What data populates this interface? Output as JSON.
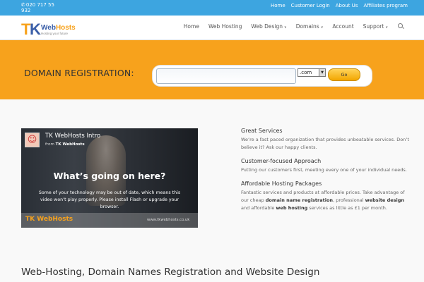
{
  "topbar": {
    "phone": "020 717 55 932",
    "links": [
      "Home",
      "Customer Login",
      "About Us",
      "Affiliates program"
    ]
  },
  "header": {
    "logo": {
      "initials": "TK",
      "name": "WebHosts",
      "tagline": "Hosting your future"
    },
    "nav": [
      {
        "label": "Home",
        "has_dropdown": false
      },
      {
        "label": "Web Hosting",
        "has_dropdown": false
      },
      {
        "label": "Web Design",
        "has_dropdown": true
      },
      {
        "label": "Domains",
        "has_dropdown": true
      },
      {
        "label": "Account",
        "has_dropdown": false
      },
      {
        "label": "Support",
        "has_dropdown": true
      }
    ],
    "search_icon": "search-icon"
  },
  "domain_search": {
    "label": "DOMAIN REGISTRATION:",
    "input_value": "",
    "tld_selected": ".com",
    "go_label": "Go"
  },
  "video": {
    "title": "TK WebHosts Intro",
    "from_prefix": "from",
    "from_name": "TK WebHosts",
    "headline": "What’s going on here?",
    "message": "Some of your technology may be out of date, which means this video won’t play properly. Please install Flash or upgrade your browser.",
    "footer_logo": "TK WebHosts",
    "footer_url": "www.tkwebhosts.co.uk"
  },
  "features": [
    {
      "title": "Great Services",
      "text": "We’re a fast paced organization that provides unbeatable services. Don’t believe it? Ask our happy clients."
    },
    {
      "title": "Customer-focused Approach",
      "text": "Putting our customers first, meeting every one of your individual needs."
    },
    {
      "title": "Affordable Hosting Packages",
      "text_parts": [
        "Fantastic services and products at affordable prices. Take advantage of our cheap ",
        "domain name registration",
        ", professional ",
        "website design",
        " and affordable ",
        "web hosting",
        " services as little as £1 per month."
      ]
    }
  ],
  "bottom_heading": "Web-Hosting, Domain Names Registration and Website Design",
  "colors": {
    "topbar": "#3da5e0",
    "domain_bar": "#f7a21c",
    "go_button": "#f2a600"
  }
}
